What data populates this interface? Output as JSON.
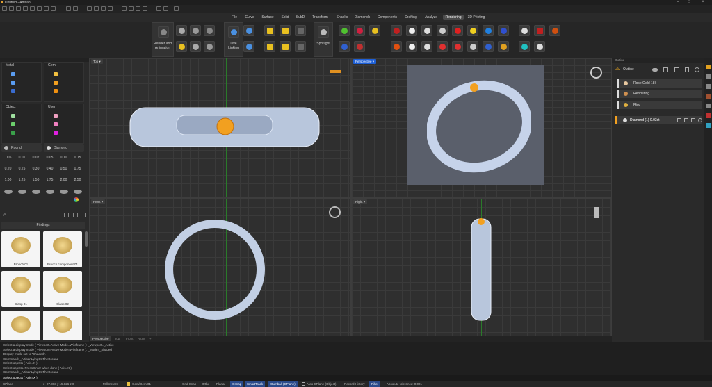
{
  "window": {
    "title": "Untitled - Artisan"
  },
  "menu": [
    "File",
    "Curve",
    "Surface",
    "Solid",
    "SubD",
    "Transform",
    "Shanks",
    "Diamonds",
    "Components",
    "Drafting",
    "Analyze",
    "Rendering",
    "3D Printing"
  ],
  "menu_active": "Rendering",
  "ribbon": {
    "render_animation": "Render and\nAnimation",
    "live_linking": "Live\nLinking",
    "spotlight": "Spotlight"
  },
  "layers": {
    "metal": "Metal",
    "gem": "Gem",
    "object": "Object",
    "user": "User"
  },
  "gems": {
    "round_label": "Round",
    "diamond_label": "Diamond",
    "sizes": [
      ".005",
      "0.01",
      "0.02",
      "0.05",
      "0.10",
      "0.15",
      "0.20",
      "0.25",
      "0.30",
      "0.40",
      "0.50",
      "0.75",
      "1.00",
      "1.25",
      "1.50",
      "1.75",
      "2.00",
      "2.50"
    ]
  },
  "findings": {
    "title": "Findings",
    "items": [
      "Brooch 01",
      "Brooch component 01",
      "Clasp 01",
      "Clasp 02",
      "",
      ""
    ]
  },
  "viewports": {
    "top": "Top",
    "perspective": "Perspective",
    "front": "Front",
    "right": "Right"
  },
  "viewport_tabs": [
    "Perspective",
    "Top",
    "Front",
    "Right",
    "+"
  ],
  "outline": {
    "header": "Outline",
    "title": "Outline",
    "items": [
      "Rose Gold 18k",
      "Rendering",
      "Ring"
    ],
    "selected": "Diamond (1) 0.03ct"
  },
  "command_history": [
    "Select a display mode ( Viewport=Active  Mode=Wireframe ): _Viewport=_Active",
    "Select a display mode ( Viewport=Active  Mode=Wireframe ): _Mode=_Shaded",
    "Display mode set to \"Shaded\".",
    "Command: _ArtisanLyingOnTheGround",
    "Select objects ( Axis=X )",
    "Select objects. Press Enter when done ( Axis=X )",
    "Command: _ArtisanLyingOnTheGround"
  ],
  "command_prompt": "Select objects ( Axis=X )",
  "status": {
    "cplane": "CPlane",
    "coords": "x -27.363  y 15.826  z 0",
    "units": "Millimeters",
    "layer": "Gem/Gem 01",
    "grid_snap": "Grid Snap",
    "ortho": "Ortho",
    "planar": "Planar",
    "osnap": "Osnap",
    "smarttrack": "SmartTrack",
    "gumball": "Gumball (CPlane)",
    "auto_cplane": "Auto CPlane (Object)",
    "record_history": "Record History",
    "filter": "Filter",
    "tolerance": "Absolute tolerance: 0.001"
  },
  "colors": {
    "accent": "#1d5fd6",
    "gem_orange": "#f2a020",
    "metal_blue": "#5a9cf0",
    "object_green": "#6ccf6c",
    "user_pink": "#f080c0",
    "user_magenta": "#e020e0"
  }
}
